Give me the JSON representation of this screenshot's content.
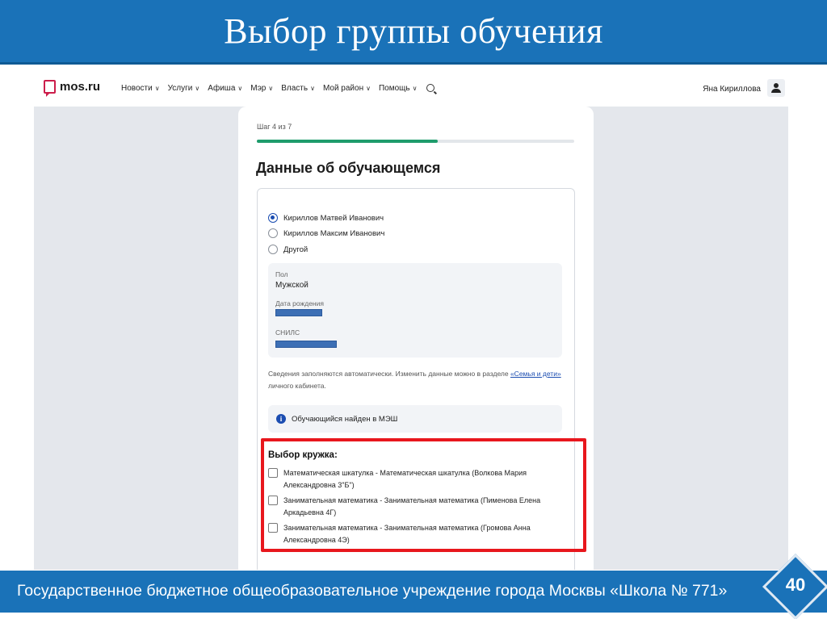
{
  "slide": {
    "title": "Выбор группы обучения",
    "footer": "Государственное бюджетное общеобразовательное учреждение города Москвы «Школа № 771»",
    "page_number": "40"
  },
  "site": {
    "logo_text": "mos.ru",
    "menu": [
      {
        "label": "Новости"
      },
      {
        "label": "Услуги"
      },
      {
        "label": "Афиша"
      },
      {
        "label": "Мэр"
      },
      {
        "label": "Власть"
      },
      {
        "label": "Мой район"
      },
      {
        "label": "Помощь"
      }
    ],
    "user_name": "Яна Кириллова"
  },
  "form": {
    "step": "Шаг 4 из 7",
    "progress_fraction": 0.571,
    "title": "Данные об обучающемся",
    "students": [
      {
        "label": "Кириллов Матвей Иванович",
        "checked": true
      },
      {
        "label": "Кириллов Максим Иванович",
        "checked": false
      },
      {
        "label": "Другой",
        "checked": false
      }
    ],
    "gender_label": "Пол",
    "gender_value": "Мужской",
    "birth_label": "Дата рождения",
    "snils_label": "СНИЛС",
    "note_before": "Сведения заполняются автоматически. Изменить данные можно в разделе ",
    "note_link": "«Семья и дети»",
    "note_after": " личного кабинета.",
    "found_text": "Обучающийся найден в МЭШ",
    "clubs_title": "Выбор кружка:",
    "clubs": [
      {
        "label": "Математическая шкатулка - Математическая шкатулка (Волкова Мария Александровна 3\"Б\")"
      },
      {
        "label": "Занимательная математика - Занимательная математика (Пименова Елена Аркадьевна 4Г)"
      },
      {
        "label": "Занимательная математика - Занимательная математика (Громова Анна Александровна 4Э)"
      }
    ]
  },
  "colors": {
    "slide_blue": "#1a72b8",
    "highlight_red": "#e8171d",
    "progress_green": "#1e9c6c",
    "accent_blue": "#1b4db1"
  }
}
